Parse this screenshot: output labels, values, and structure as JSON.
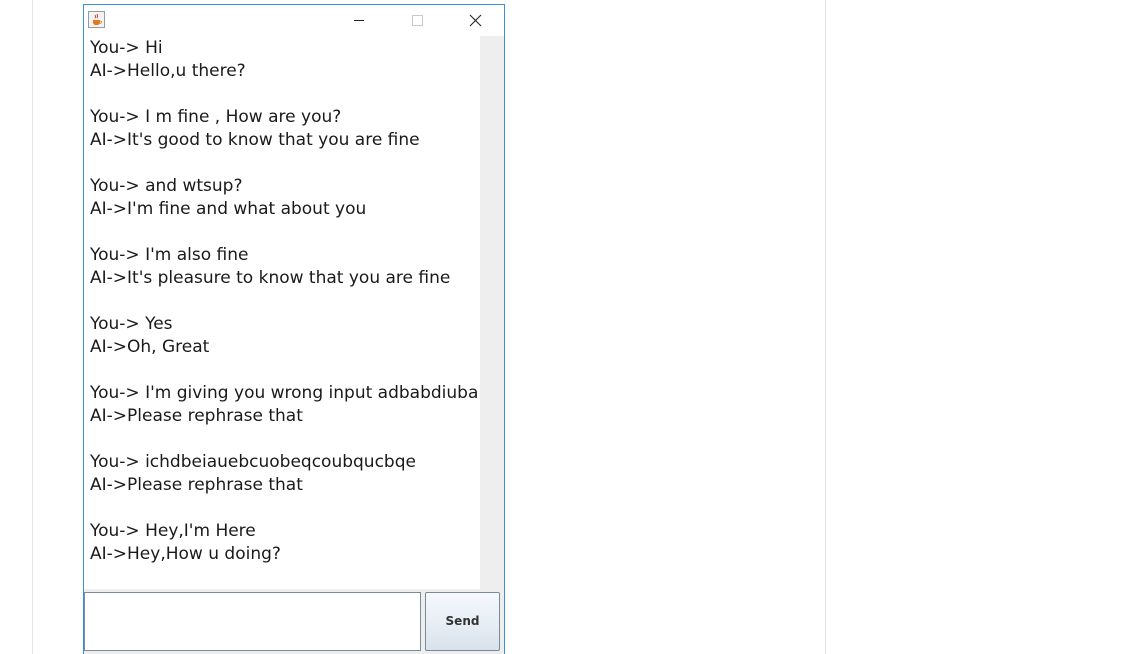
{
  "chat": {
    "transcript": "You-> Hi\nAI->Hello,u there?\n\nYou-> I m fine , How are you?\nAI->It's good to know that you are fine\n\nYou-> and wtsup?\nAI->I'm fine and what about you\n\nYou-> I'm also fine\nAI->It's pleasure to know that you are fine\n\nYou-> Yes\nAI->Oh, Great\n\nYou-> I'm giving you wrong input adbabdiuba\nAI->Please rephrase that\n\nYou-> ichdbeiauebcuobeqcoubqucbqe\nAI->Please rephrase that\n\nYou-> Hey,I'm Here\nAI->Hey,How u doing?"
  },
  "input": {
    "value": ""
  },
  "send_button": {
    "label": "Send"
  },
  "titlebar": {
    "icons": {
      "app": "java-app-icon",
      "minimize": "minimize-icon",
      "maximize": "maximize-icon",
      "close": "close-icon"
    }
  },
  "colors": {
    "window_border": "#3c8ed6",
    "scrollbar_track": "#eeeeee",
    "button_gradient_top": "#f6f9fc",
    "button_gradient_bottom": "#d9e3ed"
  }
}
